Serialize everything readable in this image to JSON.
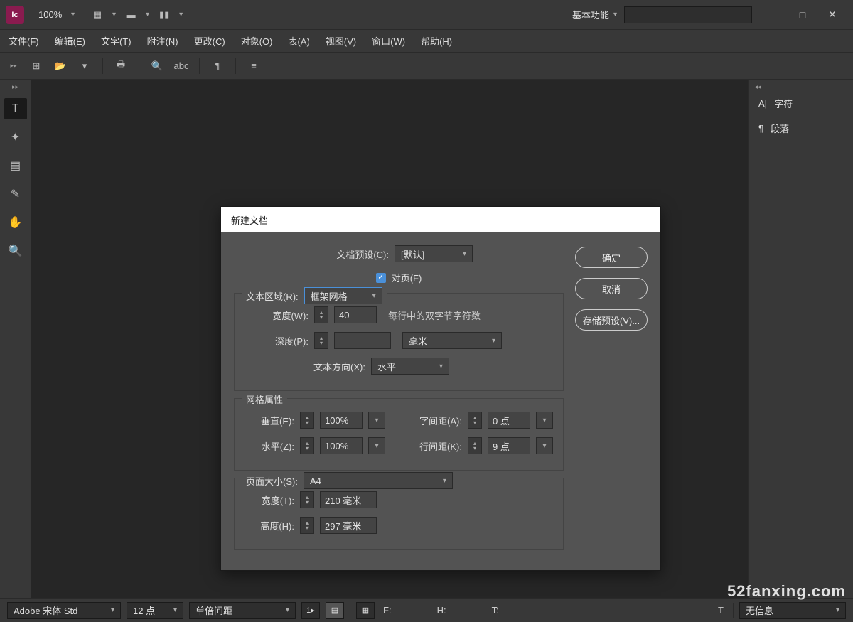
{
  "app": {
    "logo": "Ic",
    "zoom": "100%",
    "workspace": "基本功能"
  },
  "window": {
    "min": "—",
    "max": "□",
    "close": "✕"
  },
  "menu": [
    "文件(F)",
    "编辑(E)",
    "文字(T)",
    "附注(N)",
    "更改(C)",
    "对象(O)",
    "表(A)",
    "视图(V)",
    "窗口(W)",
    "帮助(H)"
  ],
  "right_panel": {
    "char": "字符",
    "para": "段落"
  },
  "dialog": {
    "title": "新建文档",
    "preset_label": "文档预设(C):",
    "preset_value": "[默认]",
    "facing_label": "对页(F)",
    "ok": "确定",
    "cancel": "取消",
    "save_preset": "存储预设(V)...",
    "text_area": {
      "legend": "文本区域(R):",
      "type": "框架网格",
      "width_label": "宽度(W):",
      "width_value": "40",
      "width_hint": "每行中的双字节字符数",
      "depth_label": "深度(P):",
      "depth_value": "",
      "depth_unit": "毫米",
      "orient_label": "文本方向(X):",
      "orient_value": "水平"
    },
    "grid": {
      "legend": "网格属性",
      "vert_label": "垂直(E):",
      "vert_value": "100%",
      "horz_label": "水平(Z):",
      "horz_value": "100%",
      "char_sp_label": "字间距(A):",
      "char_sp_value": "0 点",
      "line_sp_label": "行间距(K):",
      "line_sp_value": "9 点"
    },
    "page": {
      "legend": "页面大小(S):",
      "size": "A4",
      "width_label": "宽度(T):",
      "width_value": "210 毫米",
      "height_label": "高度(H):",
      "height_value": "297 毫米"
    }
  },
  "bottom": {
    "font": "Adobe 宋体 Std",
    "size": "12 点",
    "leading": "单倍间距",
    "f": "F:",
    "h": "H:",
    "t": "T:",
    "info": "无信息"
  },
  "watermark": "52fanxing.com"
}
